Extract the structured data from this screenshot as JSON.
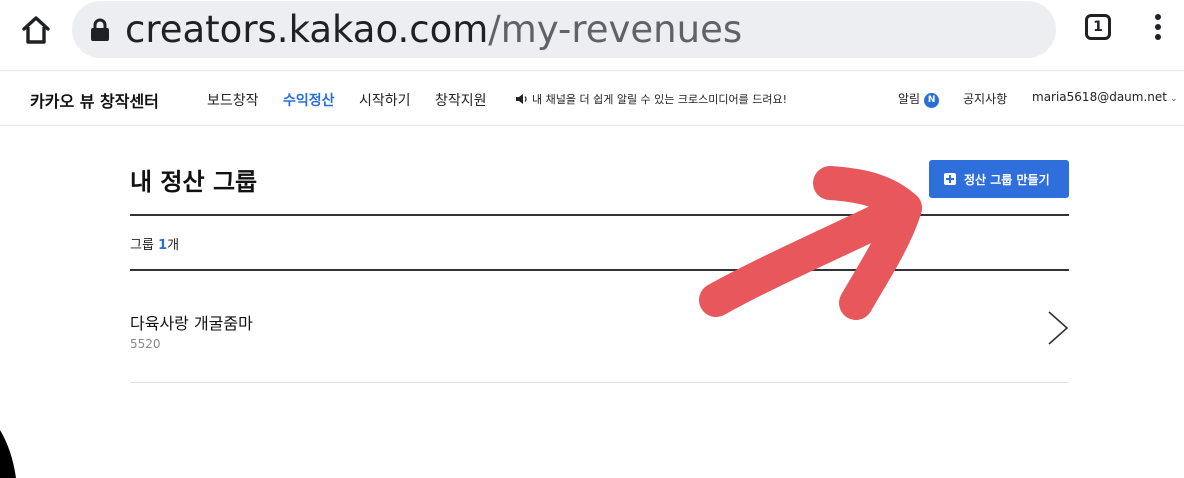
{
  "browser": {
    "url_host": "creators.kakao.com",
    "url_path": "/my-revenues",
    "tab_count": "1"
  },
  "site": {
    "brand": "카카오 뷰 창작센터",
    "nav": [
      "보드창작",
      "수익정산",
      "시작하기",
      "창작지원"
    ],
    "promo": "내 채널을 더 쉽게 알릴 수 있는 크로스미디어를 드려요!",
    "alarm_label": "알림",
    "alarm_badge": "N",
    "notice": "공지사항",
    "account": "maria5618@daum.net"
  },
  "main": {
    "title": "내 정산 그룹",
    "create_button": "정산 그룹 만들기",
    "count_prefix": "그룹 ",
    "count_value": "1",
    "count_suffix": "개",
    "groups": [
      {
        "name": "다육사랑 개굴줌마",
        "code": "5520"
      }
    ]
  },
  "colors": {
    "accent": "#2a6fd6",
    "button": "#2f6fdc",
    "annotation_arrow": "#e8575c"
  }
}
